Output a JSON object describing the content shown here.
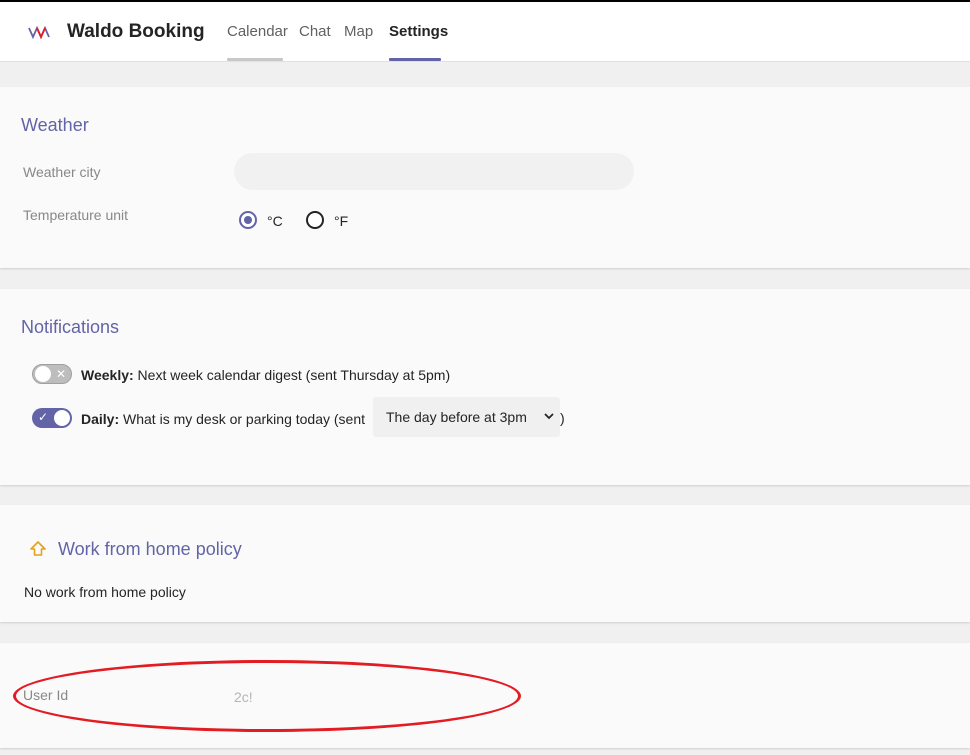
{
  "app": {
    "title": "Waldo Booking",
    "logo_icon": "waldo-logo-icon"
  },
  "tabs": [
    {
      "label": "Calendar"
    },
    {
      "label": "Chat"
    },
    {
      "label": "Map"
    },
    {
      "label": "Settings"
    }
  ],
  "colors": {
    "accent": "#6264a7",
    "annotation": "#e31b23",
    "icon_yellow": "#e4a11b"
  },
  "weather": {
    "title": "Weather",
    "city_label": "Weather city",
    "city_value": "",
    "unit_label": "Temperature unit",
    "unit_celsius": "°C",
    "unit_fahrenheit": "°F",
    "selected_unit": "°C"
  },
  "notifications": {
    "title": "Notifications",
    "weekly": {
      "bold": "Weekly:",
      "text": " Next week calendar digest (sent Thursday at 5pm)",
      "enabled": false
    },
    "daily": {
      "bold": "Daily:",
      "text": " What is my desk or parking today (sent",
      "enabled": true,
      "select_value": "The day before at 3pm",
      "closing": ")"
    }
  },
  "wfh": {
    "title": "Work from home policy",
    "icon": "home-arrow-icon",
    "text": "No work from home policy"
  },
  "user": {
    "label": "User Id",
    "value": "2c!"
  }
}
